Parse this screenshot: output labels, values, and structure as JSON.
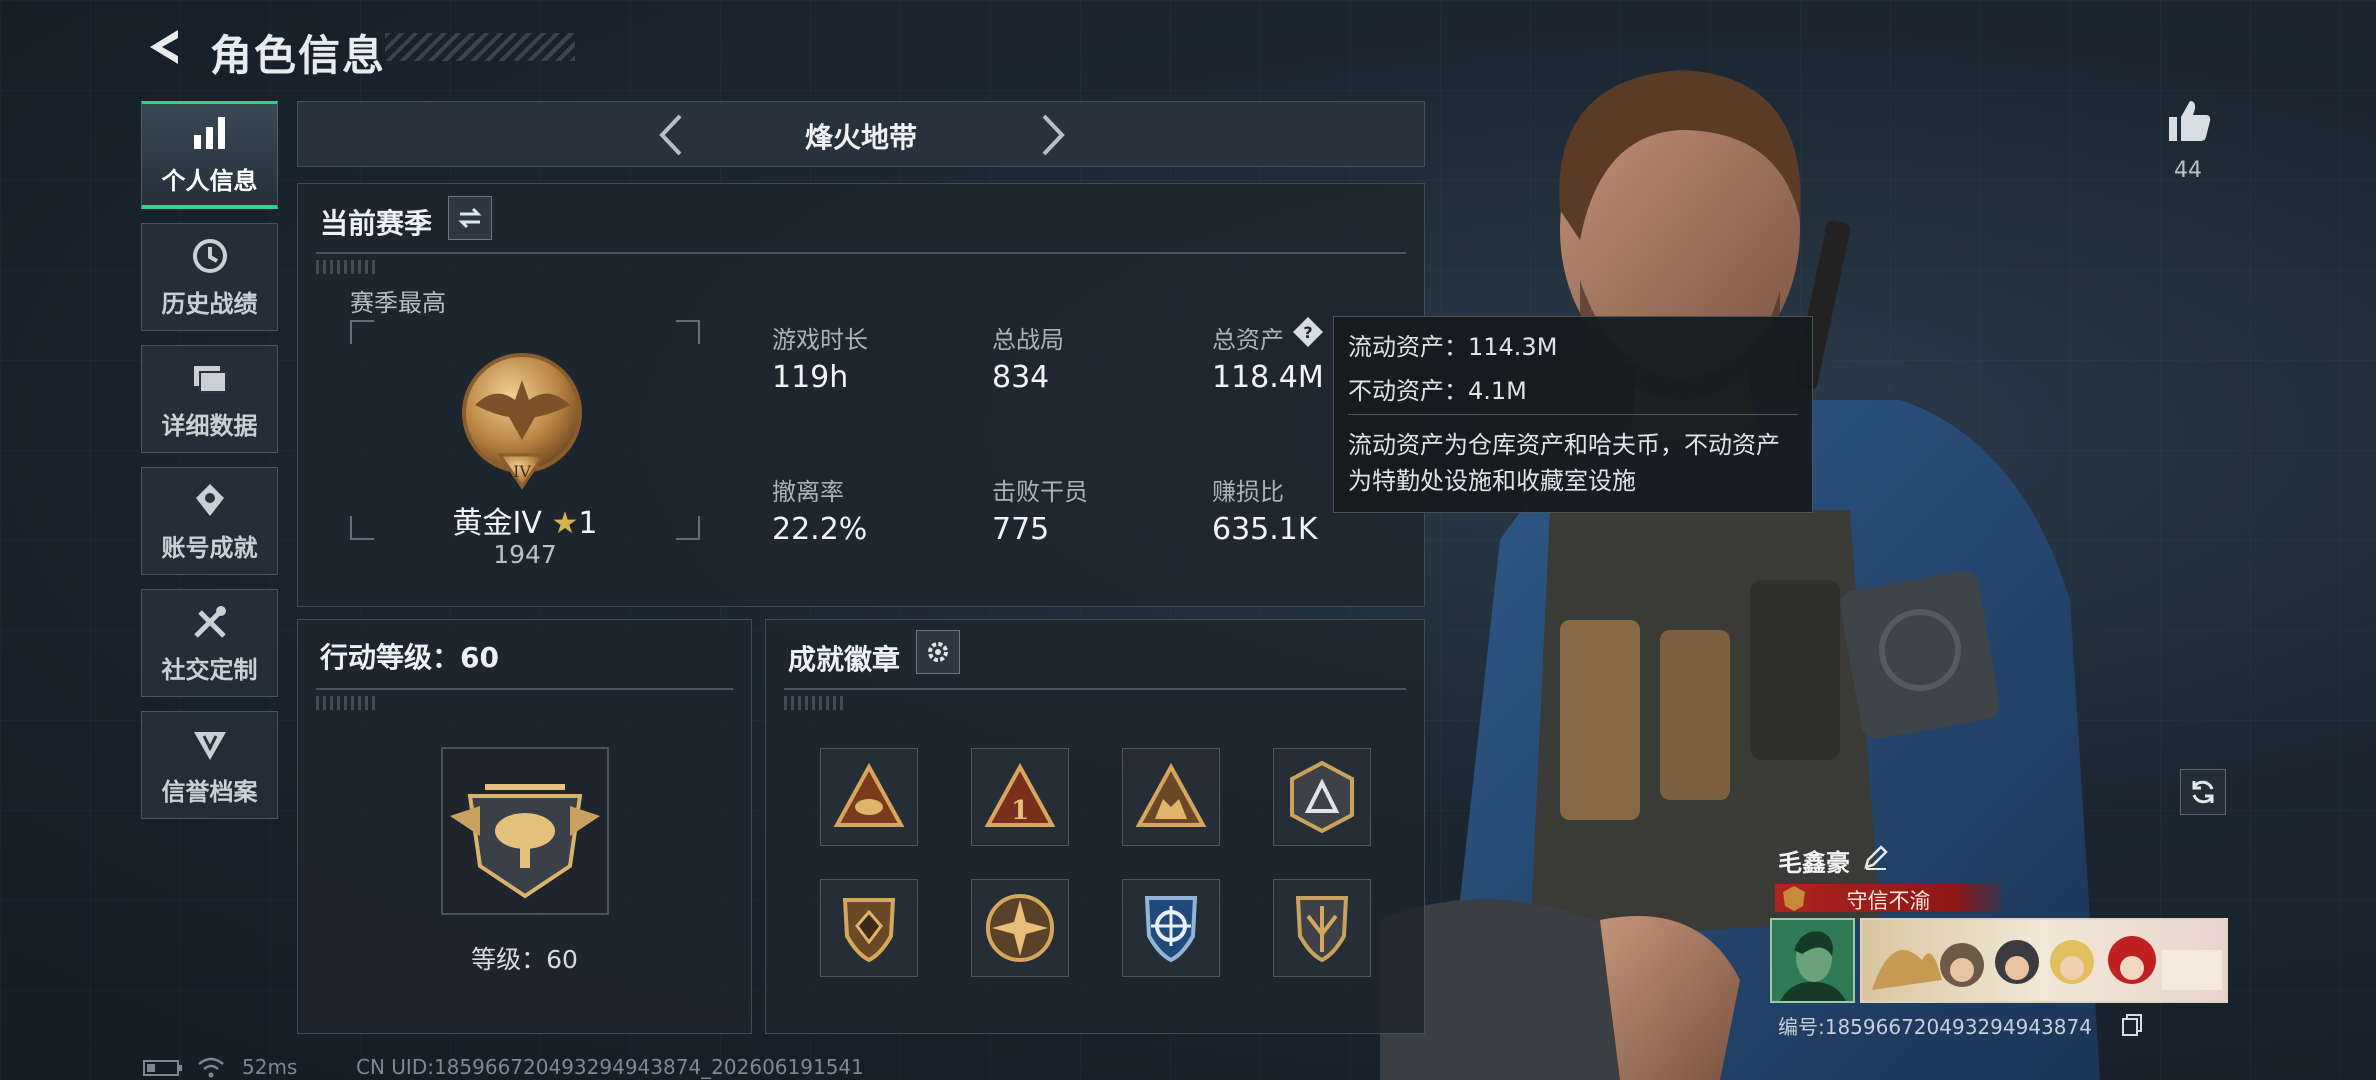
{
  "header": {
    "title": "角色信息"
  },
  "nav": {
    "items": [
      {
        "label": "个人信息",
        "icon": "bar-chart-icon",
        "active": true
      },
      {
        "label": "历史战绩",
        "icon": "history-clock-icon",
        "active": false
      },
      {
        "label": "详细数据",
        "icon": "folders-icon",
        "active": false
      },
      {
        "label": "账号成就",
        "icon": "achievement-icon",
        "active": false
      },
      {
        "label": "社交定制",
        "icon": "tools-icon",
        "active": false
      },
      {
        "label": "信誉档案",
        "icon": "credit-shield-icon",
        "active": false
      }
    ]
  },
  "mode": {
    "title": "烽火地带"
  },
  "season": {
    "title": "当前赛季",
    "best_label": "赛季最高",
    "rank_name": "黄金IV",
    "rank_stars": "1",
    "rank_score": "1947",
    "rank_emblem_numeral": "IV",
    "stats": [
      {
        "label": "游戏时长",
        "value": "119h"
      },
      {
        "label": "总战局",
        "value": "834"
      },
      {
        "label": "总资产",
        "value": "118.4M"
      },
      {
        "label": "撤离率",
        "value": "22.2%"
      },
      {
        "label": "击败干员",
        "value": "775"
      },
      {
        "label": "赚损比",
        "value": "635.1K"
      }
    ]
  },
  "tooltip": {
    "liquid": "流动资产：114.3M",
    "fixed": "不动资产：4.1M",
    "note_line1": "流动资产为仓库资产和哈夫币，不动资产",
    "note_line2": "为特勤处设施和收藏室设施"
  },
  "action_level": {
    "title": "行动等级：60",
    "level_label": "等级：60"
  },
  "badges": {
    "title": "成就徽章",
    "items": [
      "triangle-eye-badge",
      "triangle-one-badge",
      "triangle-beast-badge",
      "hexagon-arrow-badge",
      "shield-gem-badge",
      "sun-star-badge",
      "blue-crosshair-badge",
      "shield-wings-badge"
    ]
  },
  "likes": {
    "count": "44"
  },
  "player": {
    "name": "毛鑫豪",
    "title": "守信不渝",
    "uid": "编号:185966720493294943874"
  },
  "footer": {
    "ping": "52ms",
    "uid": "CN UID:185966720493294943874_202606191541"
  },
  "colors": {
    "accent_green": "#2bd58a",
    "title_red": "#b1231f",
    "gold": "#c89a4e"
  }
}
